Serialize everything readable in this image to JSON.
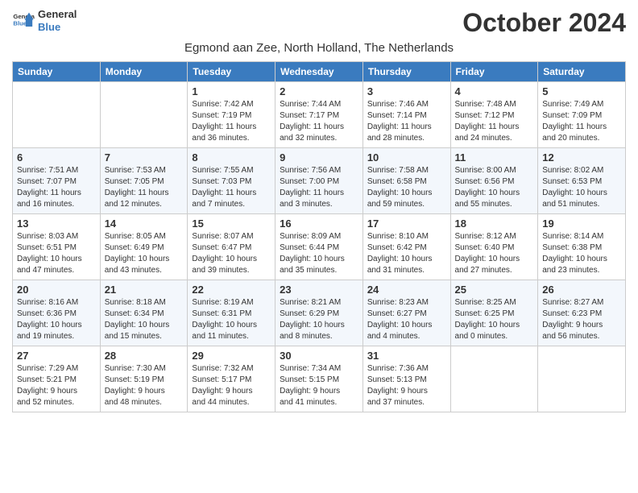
{
  "header": {
    "logo_general": "General",
    "logo_blue": "Blue",
    "month_title": "October 2024",
    "subtitle": "Egmond aan Zee, North Holland, The Netherlands"
  },
  "days_of_week": [
    "Sunday",
    "Monday",
    "Tuesday",
    "Wednesday",
    "Thursday",
    "Friday",
    "Saturday"
  ],
  "weeks": [
    [
      {
        "day": "",
        "detail": ""
      },
      {
        "day": "",
        "detail": ""
      },
      {
        "day": "1",
        "detail": "Sunrise: 7:42 AM\nSunset: 7:19 PM\nDaylight: 11 hours\nand 36 minutes."
      },
      {
        "day": "2",
        "detail": "Sunrise: 7:44 AM\nSunset: 7:17 PM\nDaylight: 11 hours\nand 32 minutes."
      },
      {
        "day": "3",
        "detail": "Sunrise: 7:46 AM\nSunset: 7:14 PM\nDaylight: 11 hours\nand 28 minutes."
      },
      {
        "day": "4",
        "detail": "Sunrise: 7:48 AM\nSunset: 7:12 PM\nDaylight: 11 hours\nand 24 minutes."
      },
      {
        "day": "5",
        "detail": "Sunrise: 7:49 AM\nSunset: 7:09 PM\nDaylight: 11 hours\nand 20 minutes."
      }
    ],
    [
      {
        "day": "6",
        "detail": "Sunrise: 7:51 AM\nSunset: 7:07 PM\nDaylight: 11 hours\nand 16 minutes."
      },
      {
        "day": "7",
        "detail": "Sunrise: 7:53 AM\nSunset: 7:05 PM\nDaylight: 11 hours\nand 12 minutes."
      },
      {
        "day": "8",
        "detail": "Sunrise: 7:55 AM\nSunset: 7:03 PM\nDaylight: 11 hours\nand 7 minutes."
      },
      {
        "day": "9",
        "detail": "Sunrise: 7:56 AM\nSunset: 7:00 PM\nDaylight: 11 hours\nand 3 minutes."
      },
      {
        "day": "10",
        "detail": "Sunrise: 7:58 AM\nSunset: 6:58 PM\nDaylight: 10 hours\nand 59 minutes."
      },
      {
        "day": "11",
        "detail": "Sunrise: 8:00 AM\nSunset: 6:56 PM\nDaylight: 10 hours\nand 55 minutes."
      },
      {
        "day": "12",
        "detail": "Sunrise: 8:02 AM\nSunset: 6:53 PM\nDaylight: 10 hours\nand 51 minutes."
      }
    ],
    [
      {
        "day": "13",
        "detail": "Sunrise: 8:03 AM\nSunset: 6:51 PM\nDaylight: 10 hours\nand 47 minutes."
      },
      {
        "day": "14",
        "detail": "Sunrise: 8:05 AM\nSunset: 6:49 PM\nDaylight: 10 hours\nand 43 minutes."
      },
      {
        "day": "15",
        "detail": "Sunrise: 8:07 AM\nSunset: 6:47 PM\nDaylight: 10 hours\nand 39 minutes."
      },
      {
        "day": "16",
        "detail": "Sunrise: 8:09 AM\nSunset: 6:44 PM\nDaylight: 10 hours\nand 35 minutes."
      },
      {
        "day": "17",
        "detail": "Sunrise: 8:10 AM\nSunset: 6:42 PM\nDaylight: 10 hours\nand 31 minutes."
      },
      {
        "day": "18",
        "detail": "Sunrise: 8:12 AM\nSunset: 6:40 PM\nDaylight: 10 hours\nand 27 minutes."
      },
      {
        "day": "19",
        "detail": "Sunrise: 8:14 AM\nSunset: 6:38 PM\nDaylight: 10 hours\nand 23 minutes."
      }
    ],
    [
      {
        "day": "20",
        "detail": "Sunrise: 8:16 AM\nSunset: 6:36 PM\nDaylight: 10 hours\nand 19 minutes."
      },
      {
        "day": "21",
        "detail": "Sunrise: 8:18 AM\nSunset: 6:34 PM\nDaylight: 10 hours\nand 15 minutes."
      },
      {
        "day": "22",
        "detail": "Sunrise: 8:19 AM\nSunset: 6:31 PM\nDaylight: 10 hours\nand 11 minutes."
      },
      {
        "day": "23",
        "detail": "Sunrise: 8:21 AM\nSunset: 6:29 PM\nDaylight: 10 hours\nand 8 minutes."
      },
      {
        "day": "24",
        "detail": "Sunrise: 8:23 AM\nSunset: 6:27 PM\nDaylight: 10 hours\nand 4 minutes."
      },
      {
        "day": "25",
        "detail": "Sunrise: 8:25 AM\nSunset: 6:25 PM\nDaylight: 10 hours\nand 0 minutes."
      },
      {
        "day": "26",
        "detail": "Sunrise: 8:27 AM\nSunset: 6:23 PM\nDaylight: 9 hours\nand 56 minutes."
      }
    ],
    [
      {
        "day": "27",
        "detail": "Sunrise: 7:29 AM\nSunset: 5:21 PM\nDaylight: 9 hours\nand 52 minutes."
      },
      {
        "day": "28",
        "detail": "Sunrise: 7:30 AM\nSunset: 5:19 PM\nDaylight: 9 hours\nand 48 minutes."
      },
      {
        "day": "29",
        "detail": "Sunrise: 7:32 AM\nSunset: 5:17 PM\nDaylight: 9 hours\nand 44 minutes."
      },
      {
        "day": "30",
        "detail": "Sunrise: 7:34 AM\nSunset: 5:15 PM\nDaylight: 9 hours\nand 41 minutes."
      },
      {
        "day": "31",
        "detail": "Sunrise: 7:36 AM\nSunset: 5:13 PM\nDaylight: 9 hours\nand 37 minutes."
      },
      {
        "day": "",
        "detail": ""
      },
      {
        "day": "",
        "detail": ""
      }
    ]
  ]
}
